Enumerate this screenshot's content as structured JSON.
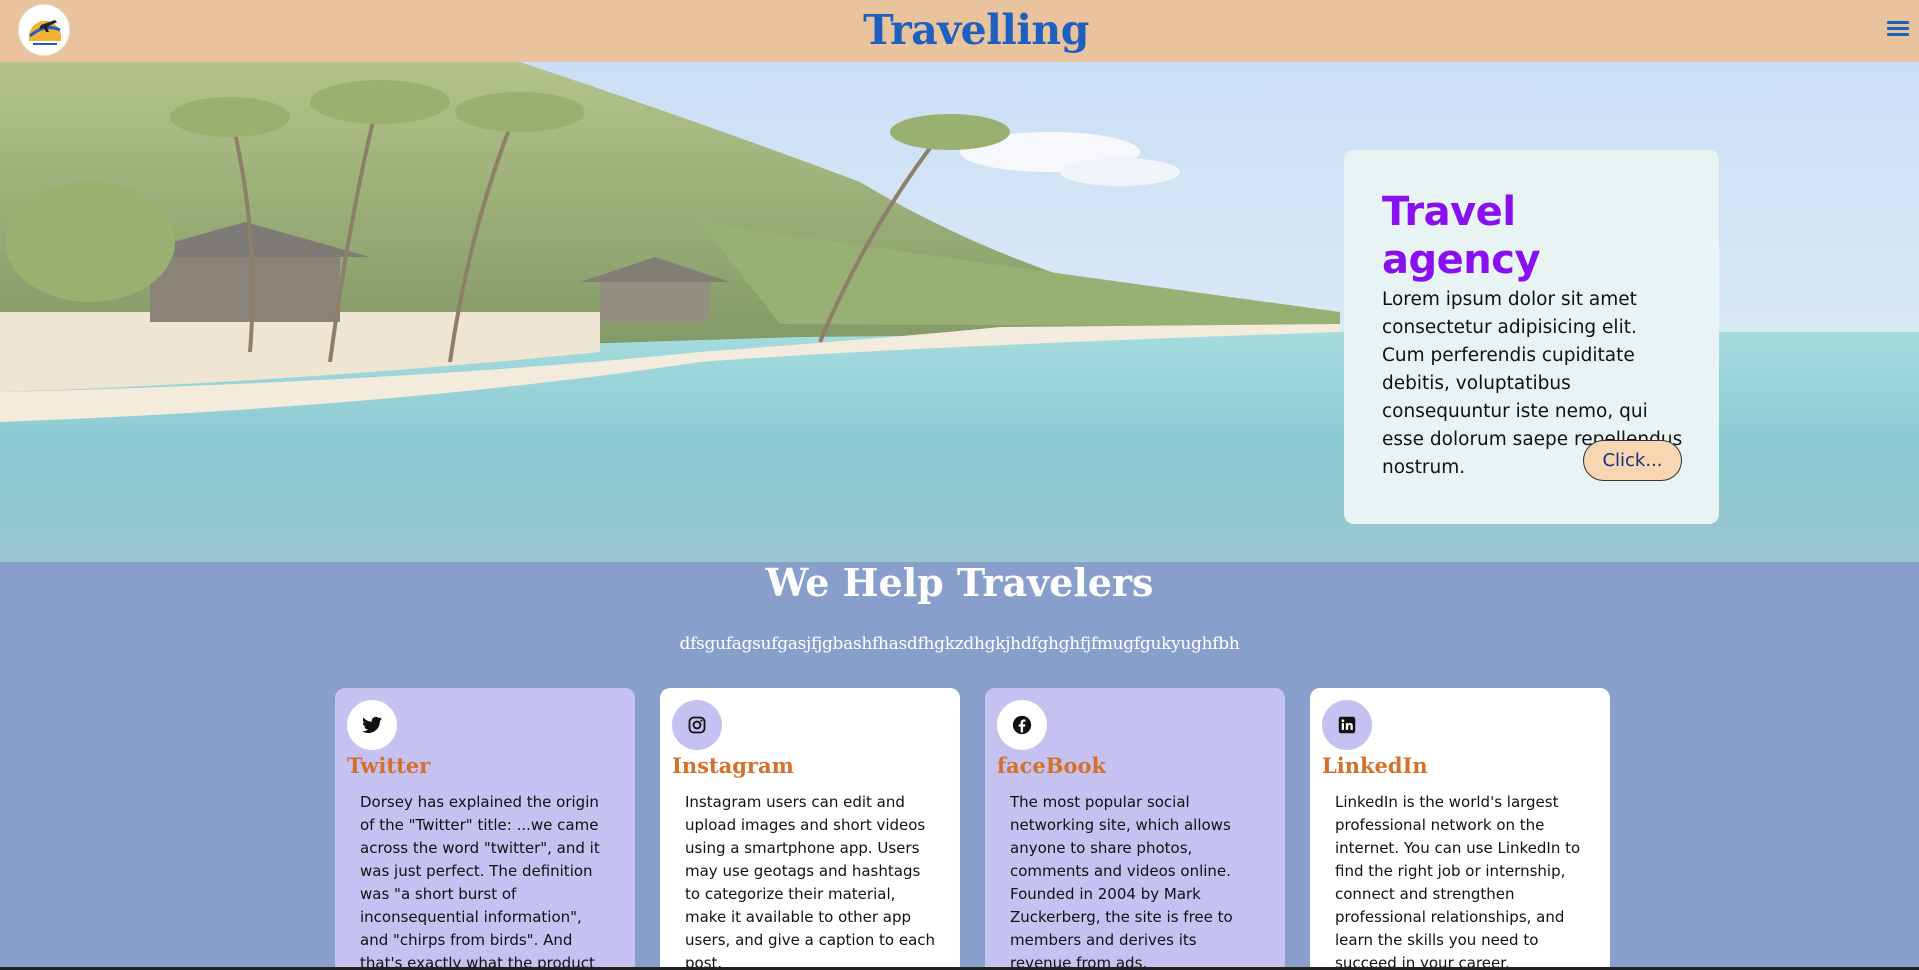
{
  "header": {
    "title": "Travelling",
    "logo_icon": "travel-logo-icon",
    "menu_icon": "hamburger-menu-icon"
  },
  "hero": {
    "card_title": "Travel agency",
    "card_text": "Lorem ipsum dolor sit amet consectetur adipisicing elit. Cum perferendis cupiditate debitis, voluptatibus consequuntur iste nemo, qui esse dolorum saepe repellendus nostrum.",
    "button_label": "Click..."
  },
  "section": {
    "title": "We Help Travelers",
    "subtitle": "dfsgufagsufgasjfjgbashfhasdfhgkzdhgkjhdfghghfjfmugfgukyughfbh"
  },
  "cards": [
    {
      "name": "Twitter",
      "icon": "twitter-icon",
      "text": "Dorsey has explained the origin of the \"Twitter\" title: ...we came across the word \"twitter\", and it was just perfect. The definition was \"a short burst of inconsequential information\", and \"chirps from birds\". And that's exactly what the product was."
    },
    {
      "name": "Instagram",
      "icon": "instagram-icon",
      "text": "Instagram users can edit and upload images and short videos using a smartphone app. Users may use geotags and hashtags to categorize their material, make it available to other app users, and give a caption to each post."
    },
    {
      "name": "faceBook",
      "icon": "facebook-icon",
      "text": "The most popular social networking site, which allows anyone to share photos, comments and videos online. Founded in 2004 by Mark Zuckerberg, the site is free to members and derives its revenue from ads."
    },
    {
      "name": "LinkedIn",
      "icon": "linkedin-icon",
      "text": "LinkedIn is the world's largest professional network on the internet. You can use LinkedIn to find the right job or internship, connect and strengthen professional relationships, and learn the skills you need to succeed in your career."
    }
  ],
  "colors": {
    "header_bg": "#e9c39e",
    "title_blue": "#1f5fbd",
    "agency_purple": "#8a0ff0",
    "section_bg": "#889fcb",
    "card_purple": "#c5c2f2",
    "card_name_orange": "#d5702a"
  }
}
